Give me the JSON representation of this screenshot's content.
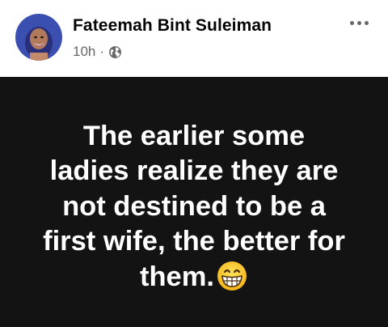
{
  "post": {
    "author_name": "Fateemah Bint Suleiman",
    "timestamp": "10h",
    "separator": "·",
    "audience_icon": "globe-icon",
    "more_icon": "more-options-icon",
    "body_text": "The earlier some ladies realize they are not destined to be a first wife, the better for them.",
    "emoji": "grinning-face-emoji",
    "background_color": "#131313",
    "text_color": "#ffffff"
  }
}
